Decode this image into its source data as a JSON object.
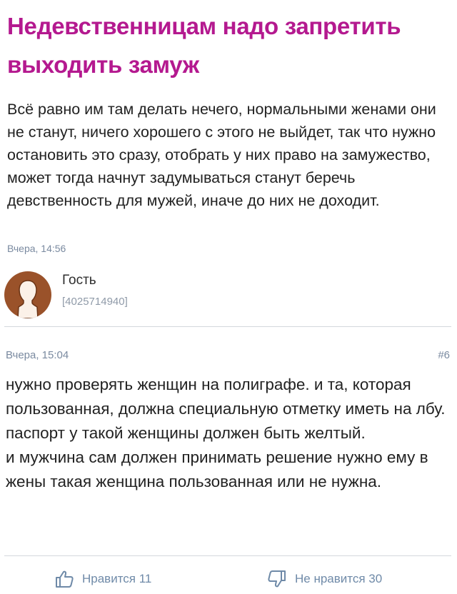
{
  "post": {
    "title": "Недевственницам надо запретить выходить замуж",
    "body": "Всё равно им там делать нечего, нормальными женами они не станут, ничего хорошего с этого не выйдет, так что нужно остановить это сразу, отобрать у них право на замужество, может тогда начнут задумываться станут беречь девственность для мужей, иначе до них не доходит.",
    "timestamp": "Вчера, 14:56"
  },
  "author": {
    "name": "Гость",
    "id": "[4025714940]",
    "avatar_icon": "user-silhouette-icon",
    "avatar_color": "#9a522a"
  },
  "comment": {
    "timestamp": "Вчера, 15:04",
    "number": "#6",
    "text": "нужно проверять женщин на полиграфе. и та, которая пользованная, должна специальную отметку иметь на лбу. паспорт у такой женщины должен быть желтый.\nи мужчина сам должен принимать решение нужно ему в жены такая женщина пользованная или не нужна."
  },
  "reactions": {
    "like_label": "Нравится 11",
    "dislike_label": "Не нравится 30",
    "like_icon": "thumbs-up-icon",
    "dislike_icon": "thumbs-down-icon",
    "accent_color": "#6f8aa8"
  },
  "colors": {
    "title": "#b4198f",
    "text": "#222222",
    "muted": "#7a8aa0"
  }
}
